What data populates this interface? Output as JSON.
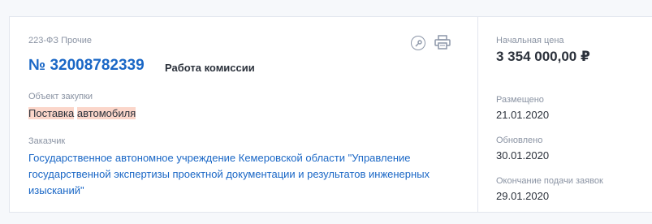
{
  "card": {
    "type_label": "223-ФЗ Прочие",
    "number": "№ 32008782339",
    "status": "Работа комиссии",
    "object": {
      "label": "Объект закупки",
      "word1": "Поставка",
      "word2": "автомобиля"
    },
    "customer": {
      "label": "Заказчик",
      "value": "Государственное автономное учреждение Кемеровской области \"Управление государственной экспертизы проектной документации и результатов инженерных изысканий\""
    },
    "icons": [
      "key-icon",
      "print-icon"
    ]
  },
  "side": {
    "price_label": "Начальная цена",
    "price_value": "3 354 000,00 ₽",
    "posted_label": "Размещено",
    "posted_value": "21.01.2020",
    "updated_label": "Обновлено",
    "updated_value": "30.01.2020",
    "deadline_label": "Окончание подачи заявок",
    "deadline_value": "29.01.2020"
  },
  "colors": {
    "link": "#1a67c6",
    "text": "#2b313b",
    "muted": "#8a93a3",
    "highlight": "#fbd6ca",
    "border": "#e2e6ee"
  }
}
